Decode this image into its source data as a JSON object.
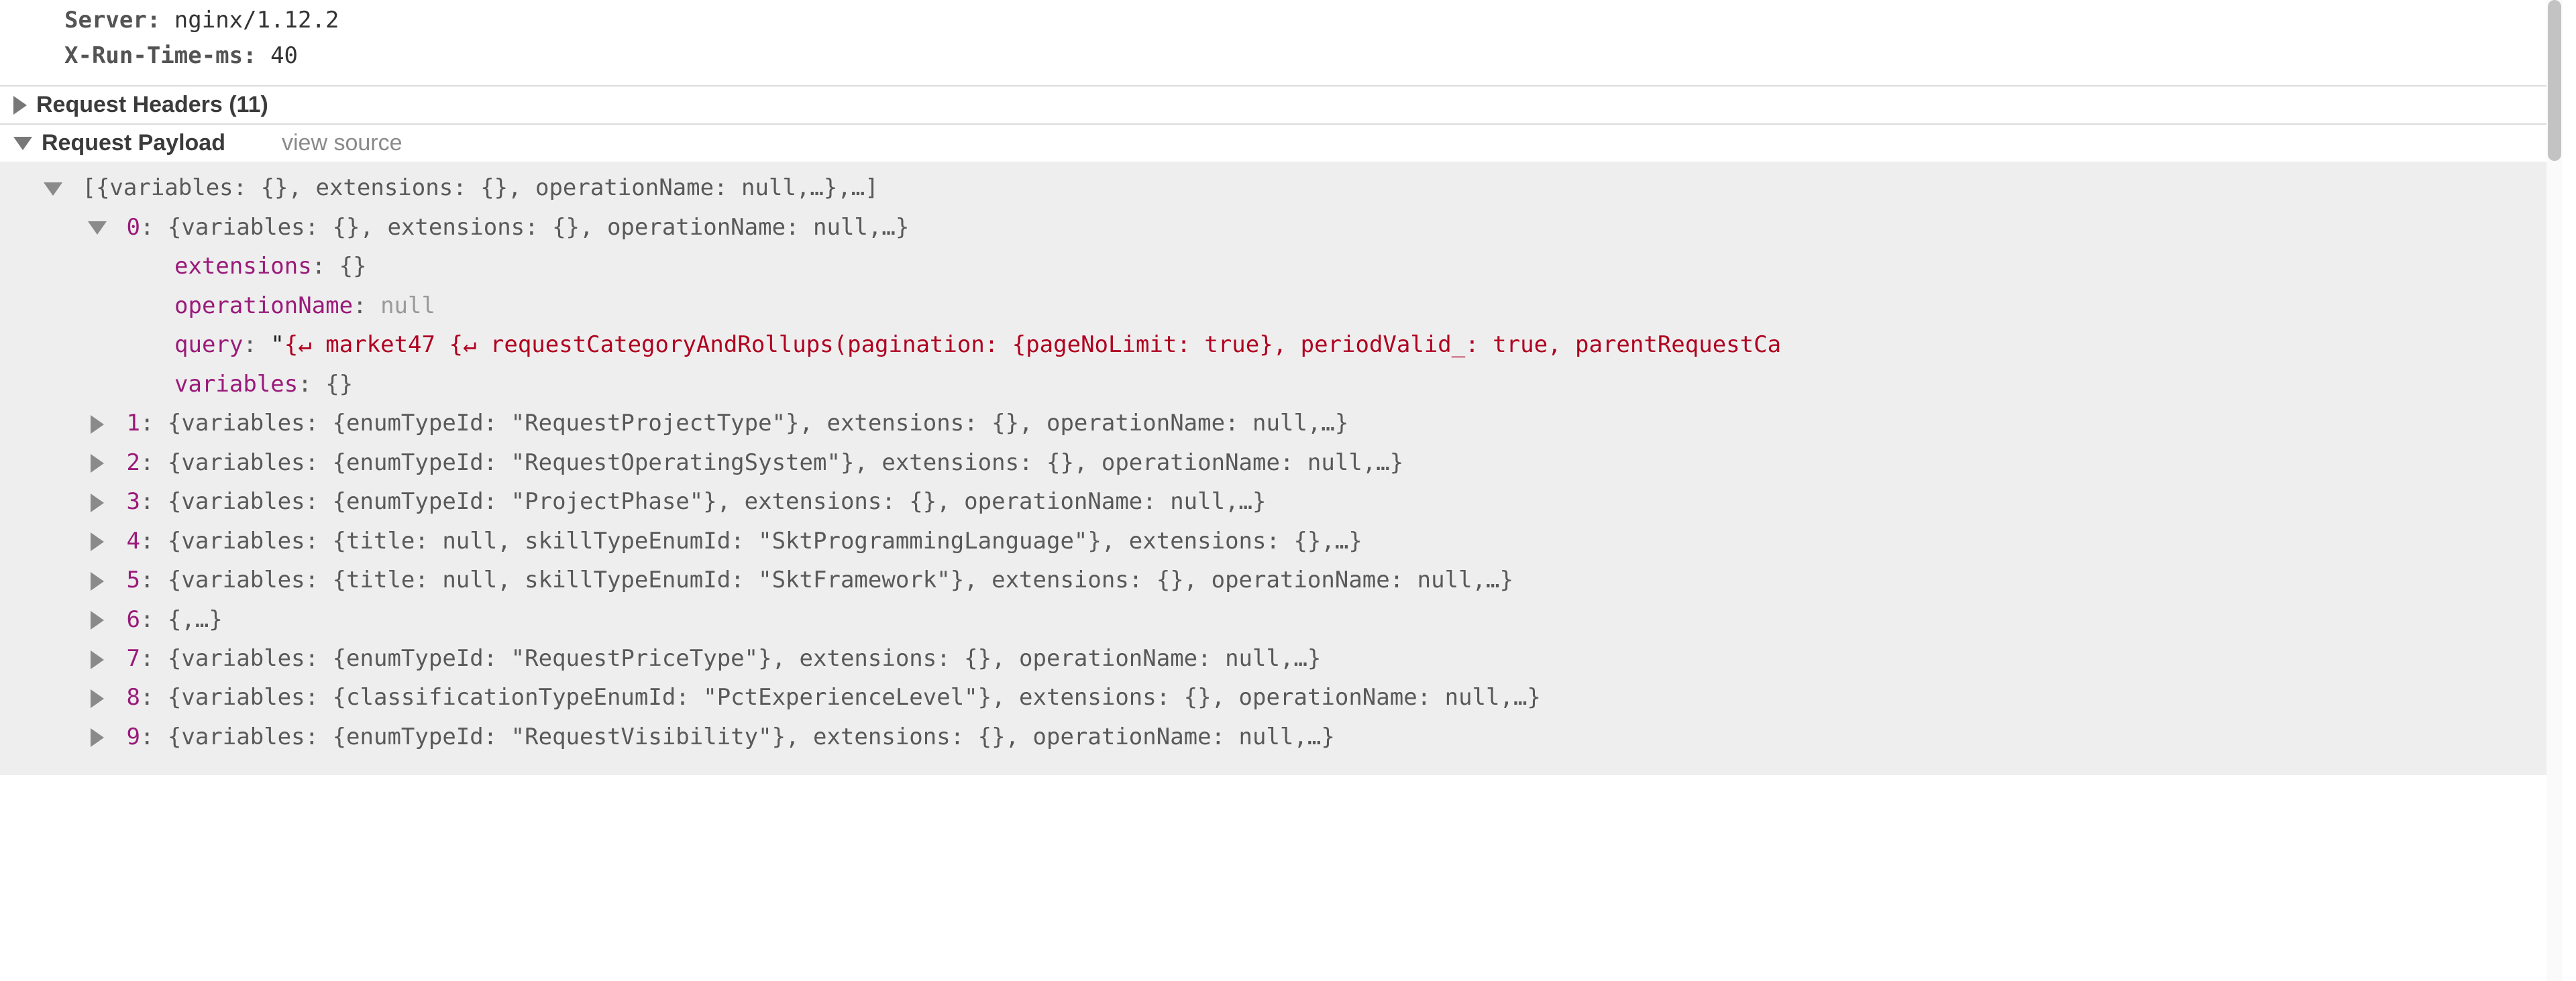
{
  "response_headers": {
    "server": {
      "name": "Server:",
      "value": "nginx/1.12.2"
    },
    "xruntime": {
      "name": "X-Run-Time-ms:",
      "value": "40"
    }
  },
  "sections": {
    "request_headers": {
      "title": "Request Headers (11)"
    },
    "request_payload": {
      "title": "Request Payload",
      "view_source": "view source"
    }
  },
  "payload": {
    "root_summary": "[{variables: {}, extensions: {}, operationName: null,…},…]",
    "item0": {
      "idx": "0",
      "summary": "{variables: {}, extensions: {}, operationName: null,…}",
      "extensions_key": "extensions",
      "extensions_val": "{}",
      "operationName_key": "operationName",
      "operationName_val": "null",
      "query_key": "query",
      "query_open_quote": "\"",
      "query_frag_a": "{",
      "query_arrow_a": "↵",
      "query_frag_b": "  market47 {",
      "query_arrow_b": "↵",
      "query_frag_c": "    requestCategoryAndRollups(pagination: {pageNoLimit: true}, periodValid_: true, parentRequestCa",
      "variables_key": "variables",
      "variables_val": "{}"
    },
    "rows": [
      {
        "idx": "1",
        "summary": "{variables: {enumTypeId: \"RequestProjectType\"}, extensions: {}, operationName: null,…}"
      },
      {
        "idx": "2",
        "summary": "{variables: {enumTypeId: \"RequestOperatingSystem\"}, extensions: {}, operationName: null,…}"
      },
      {
        "idx": "3",
        "summary": "{variables: {enumTypeId: \"ProjectPhase\"}, extensions: {}, operationName: null,…}"
      },
      {
        "idx": "4",
        "summary": "{variables: {title: null, skillTypeEnumId: \"SktProgrammingLanguage\"}, extensions: {},…}"
      },
      {
        "idx": "5",
        "summary": "{variables: {title: null, skillTypeEnumId: \"SktFramework\"}, extensions: {}, operationName: null,…}"
      },
      {
        "idx": "6",
        "summary": "{,…}"
      },
      {
        "idx": "7",
        "summary": "{variables: {enumTypeId: \"RequestPriceType\"}, extensions: {}, operationName: null,…}"
      },
      {
        "idx": "8",
        "summary": "{variables: {classificationTypeEnumId: \"PctExperienceLevel\"}, extensions: {}, operationName: null,…}"
      },
      {
        "idx": "9",
        "summary": "{variables: {enumTypeId: \"RequestVisibility\"}, extensions: {}, operationName: null,…}"
      }
    ]
  }
}
